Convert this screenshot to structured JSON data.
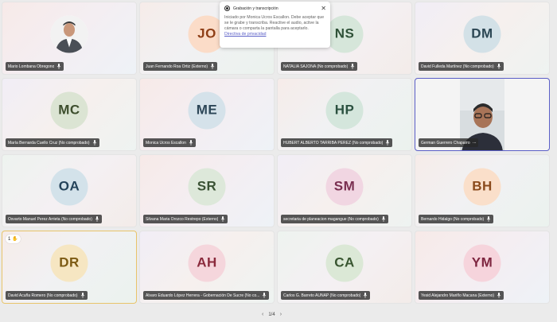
{
  "recording_popup": {
    "title": "Grabación y transcripción",
    "message": "Iniciado por Monica Ucros Escallon. Debe aceptar que se le grabe y transcriba. Reactive el audio, active la cámara o comparta la pantalla para aceptarlo.",
    "link": "Directiva de privacidad",
    "close_glyph": "✕"
  },
  "tiles": [
    {
      "name": "Mario Lombana Obregono",
      "initials": "",
      "avatar_bg": "#ffffff",
      "avatar_fg": "#333333"
    },
    {
      "name": "Juan Fernando Roa Ortiz (Externo)",
      "initials": "JO",
      "avatar_bg": "#fbdcc8",
      "avatar_fg": "#8f3f17"
    },
    {
      "name": "NATALIA SAJONA (No comprobado)",
      "initials": "NS",
      "avatar_bg": "#d6e6da",
      "avatar_fg": "#2f5138"
    },
    {
      "name": "David Fulleda Martínez (No comprobado)",
      "initials": "DM",
      "avatar_bg": "#d3e1e7",
      "avatar_fg": "#2b4653"
    },
    {
      "name": "María Bernarda Cuello Cruz (No comprobado)",
      "initials": "MC",
      "avatar_bg": "#dbe4d3",
      "avatar_fg": "#3d4e2d"
    },
    {
      "name": "Monica Ucros Escallon",
      "initials": "ME",
      "avatar_bg": "#d5e2ea",
      "avatar_fg": "#2c4657"
    },
    {
      "name": "HUBERT ALBERTO TARRIBA PEREZ (No comprobado)",
      "initials": "HP",
      "avatar_bg": "#d4e6dc",
      "avatar_fg": "#2b5140"
    },
    {
      "name": "German Guerrero Chaparro",
      "initials": "",
      "avatar_bg": "",
      "avatar_fg": ""
    },
    {
      "name": "Osvarto Manuel Perez Arrieta (No comprobado)",
      "initials": "OA",
      "avatar_bg": "#d3e2ea",
      "avatar_fg": "#24435a"
    },
    {
      "name": "Silvana Maria Orozco Restrepo (Externo)",
      "initials": "SR",
      "avatar_bg": "#dde8da",
      "avatar_fg": "#3a5234"
    },
    {
      "name": "secretaria de planeacion magangue (No comprobado)",
      "initials": "SM",
      "avatar_bg": "#f1d6e2",
      "avatar_fg": "#7a2e50"
    },
    {
      "name": "Bernardo Hidalgo (No comprobado)",
      "initials": "BH",
      "avatar_bg": "#fadfca",
      "avatar_fg": "#8a4a1c"
    },
    {
      "name": "David Acuña Romero (No comprobado)",
      "initials": "DR",
      "avatar_bg": "#f6e6c2",
      "avatar_fg": "#7c5a13"
    },
    {
      "name": "Alvaro Eduardo López Herrera - Gobernación De Sucre (No co...",
      "initials": "AH",
      "avatar_bg": "#f5d6dc",
      "avatar_fg": "#8a2a3c"
    },
    {
      "name": "Carlos G. Barreto AUNAP (No comprobado)",
      "initials": "CA",
      "avatar_bg": "#dbe8d6",
      "avatar_fg": "#385530"
    },
    {
      "name": "Yesid Alejandro Mariño Macana (Externo)",
      "initials": "YM",
      "avatar_bg": "#f6d4dc",
      "avatar_fg": "#7e2640"
    }
  ],
  "hand_badge": {
    "count": "1",
    "glyph": "✋"
  },
  "more_glyph": "···",
  "pager": {
    "label": "1/4",
    "prev": "‹",
    "next": "›"
  }
}
